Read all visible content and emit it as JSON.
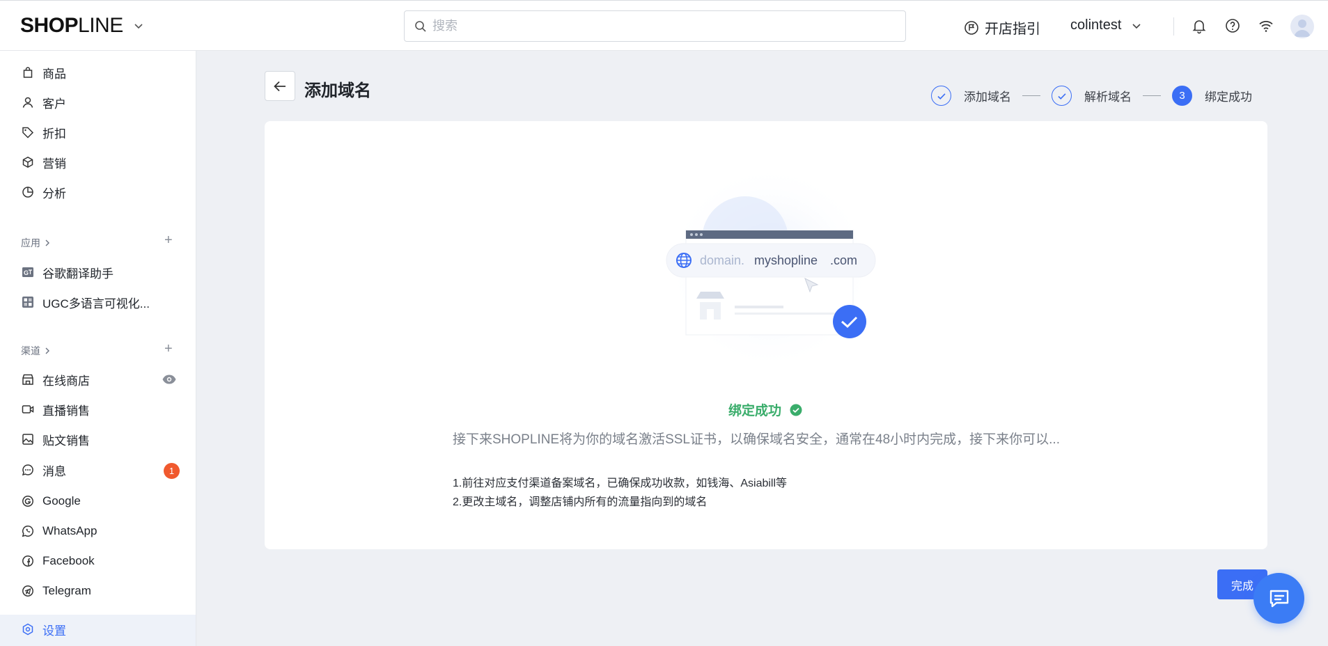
{
  "header": {
    "logo_bold": "SHOP",
    "logo_light": "LINE",
    "search_placeholder": "搜索",
    "guide_label": "开店指引",
    "username": "colintest"
  },
  "sidebar": {
    "main_items": [
      {
        "label": "商品",
        "icon": "bag-icon"
      },
      {
        "label": "客户",
        "icon": "user-icon"
      },
      {
        "label": "折扣",
        "icon": "tag-icon"
      },
      {
        "label": "营销",
        "icon": "cube-icon"
      },
      {
        "label": "分析",
        "icon": "pie-chart-icon"
      }
    ],
    "apps_title": "应用",
    "apps": [
      {
        "label": "谷歌翻译助手",
        "icon": "translate-icon"
      },
      {
        "label": "UGC多语言可视化...",
        "icon": "ugc-icon"
      }
    ],
    "channels_title": "渠道",
    "channels": [
      {
        "label": "在线商店",
        "icon": "store-icon"
      },
      {
        "label": "直播销售",
        "icon": "video-icon"
      },
      {
        "label": "贴文销售",
        "icon": "image-icon"
      },
      {
        "label": "消息",
        "icon": "chat-icon",
        "badge": "1"
      },
      {
        "label": "Google",
        "icon": "google-icon"
      },
      {
        "label": "WhatsApp",
        "icon": "whatsapp-icon"
      },
      {
        "label": "Facebook",
        "icon": "facebook-icon"
      },
      {
        "label": "Telegram",
        "icon": "telegram-icon"
      }
    ],
    "settings_label": "设置"
  },
  "main": {
    "title": "添加域名",
    "steps": [
      {
        "label": "添加域名",
        "state": "done"
      },
      {
        "label": "解析域名",
        "state": "done"
      },
      {
        "label": "绑定成功",
        "state": "current",
        "number": "3"
      }
    ],
    "illustration": {
      "domain_prefix": "domain.",
      "domain_main": "myshopline",
      "domain_suffix": ".com"
    },
    "success_title": "绑定成功",
    "description": "接下来SHOPLINE将为你的域名激活SSL证书，以确保域名安全，通常在48小时内完成，接下来你可以...",
    "notes": [
      "1.前往对应支付渠道备案域名，已确保成功收款，如钱海、Asiabill等",
      "2.更改主域名，调整店铺内所有的流量指向到的域名"
    ],
    "done_label": "完成"
  },
  "colors": {
    "accent": "#3b6ef5",
    "success": "#3aad6b",
    "badge": "#f0592e"
  }
}
